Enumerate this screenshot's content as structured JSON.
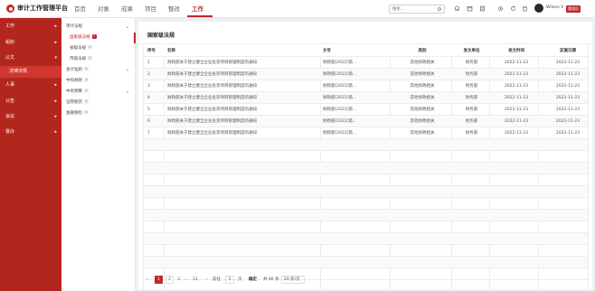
{
  "header": {
    "app_title": "审计工作管理平台",
    "nav": [
      "首页",
      "对象",
      "成果",
      "项目",
      "整改",
      "工作"
    ],
    "active_nav": "工作",
    "search_placeholder": "搜索...",
    "username": "Wilson V",
    "role": "管理员",
    "icons": [
      "search-icon",
      "bell-icon",
      "calendar-icon",
      "document-icon",
      "gear-icon",
      "refresh-icon",
      "trash-icon"
    ]
  },
  "sidebar": {
    "items": [
      {
        "label": "工作",
        "caret": "▸"
      },
      {
        "label": "组织",
        "caret": "▸"
      },
      {
        "label": "公文",
        "caret": "▾"
      },
      {
        "label": "人事",
        "caret": "▸"
      },
      {
        "label": "公告",
        "caret": "▸"
      },
      {
        "label": "会议",
        "caret": "▸"
      },
      {
        "label": "督办",
        "caret": "▸"
      }
    ],
    "sub_active": "法律法规"
  },
  "tree": {
    "root": {
      "label": "审计法规",
      "arrow": "▴"
    },
    "children": [
      {
        "label": "国家级法规",
        "count": "7"
      },
      {
        "label": "省级法规",
        "count": "0"
      },
      {
        "label": "市级法规",
        "count": "0"
      }
    ],
    "others": [
      {
        "label": "会计准则",
        "count": "0",
        "arrow": "▾"
      },
      {
        "label": "中央财政",
        "count": "0",
        "arrow": ""
      },
      {
        "label": "中央预算",
        "count": "0",
        "arrow": "▾"
      },
      {
        "label": "证券期货",
        "count": "0",
        "arrow": ""
      },
      {
        "label": "金融保险",
        "count": "0",
        "arrow": ""
      }
    ]
  },
  "main": {
    "title": "国家级法规",
    "columns": [
      "序号",
      "名称",
      "文号",
      "类别",
      "发文单位",
      "发文时间",
      "实施日期"
    ],
    "rows": [
      [
        "1",
        "财政部关于建立健全企业投资项目管理制度的通知",
        "财政部[2022]第...",
        "其他财政相关",
        "财务部",
        "2022-11-23",
        "2022-11-23"
      ],
      [
        "2",
        "财政部关于建立健全企业投资项目管理制度的通知",
        "财政部[2022]第...",
        "其他财政相关",
        "财务部",
        "2022-11-23",
        "2022-11-23"
      ],
      [
        "3",
        "财政部关于建立健全企业投资项目管理制度的通知",
        "财政部[2022]第...",
        "其他财政相关",
        "财务部",
        "2022-11-23",
        "2022-11-23"
      ],
      [
        "4",
        "财政部关于建立健全企业投资项目管理制度的通知",
        "财政部[2022]第...",
        "其他财政相关",
        "财务部",
        "2022-11-23",
        "2022-11-23"
      ],
      [
        "5",
        "财政部关于建立健全企业投资项目管理制度的通知",
        "财政部[2022]第...",
        "其他财政相关",
        "财务部",
        "2022-11-23",
        "2022-11-23"
      ],
      [
        "6",
        "财政部关于建立健全企业投资项目管理制度的通知",
        "财政部[2022]第...",
        "其他财政相关",
        "财务部",
        "2022-11-23",
        "2022-11-23"
      ],
      [
        "7",
        "财政部关于建立健全企业投资项目管理制度的通知",
        "财政部[2022]第...",
        "其他财政相关",
        "财务部",
        "2022-11-23",
        "2022-11-23"
      ]
    ],
    "empty_rows": 12
  },
  "pagination": {
    "prev": "‹",
    "pages": [
      "1",
      "2",
      "3",
      "...",
      "11"
    ],
    "next": "›",
    "goto_label": "前往",
    "goto_value": "1",
    "page_unit": "页",
    "confirm": "确定",
    "total": "共 66 条",
    "page_size": "20 条/页"
  },
  "colors": {
    "brand": "#c0282b",
    "sidebar": "#b3261e",
    "sidebar_active": "#d0372f"
  }
}
